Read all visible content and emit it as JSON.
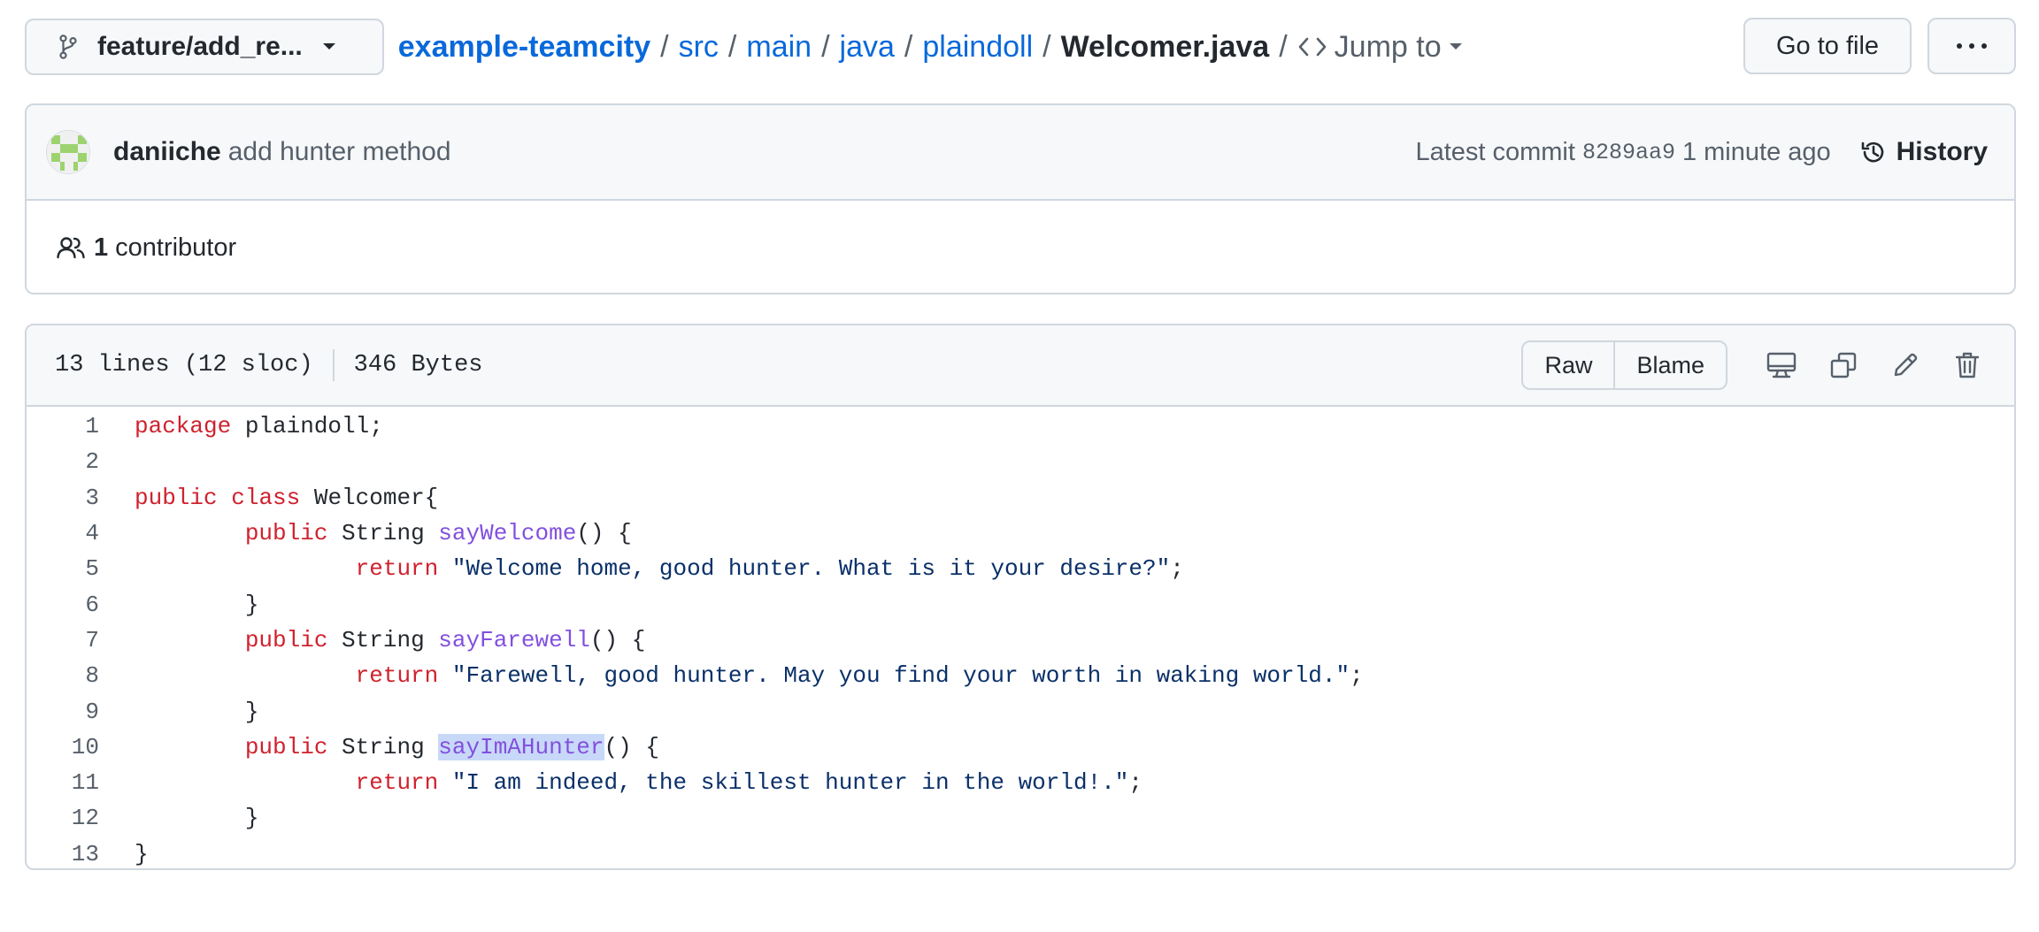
{
  "top": {
    "branch": "feature/add_re...",
    "breadcrumb": {
      "repo": "example-teamcity",
      "parts": [
        "src",
        "main",
        "java",
        "plaindoll"
      ],
      "file": "Welcomer.java",
      "separator": "/",
      "jump_to": "Jump to"
    },
    "go_to_file": "Go to file",
    "more": "···"
  },
  "commit": {
    "author": "daniiche",
    "message": "add hunter method",
    "latest_label": "Latest commit",
    "sha": "8289aa9",
    "time": "1 minute ago",
    "history": "History",
    "contributors_count": "1",
    "contributors_label": "contributor"
  },
  "file": {
    "lines_info": "13 lines (12 sloc)",
    "size": "346 Bytes",
    "raw": "Raw",
    "blame": "Blame",
    "code": [
      [
        {
          "t": "package",
          "c": "kw"
        },
        {
          "t": " plaindoll;"
        }
      ],
      [],
      [
        {
          "t": "public",
          "c": "kw"
        },
        {
          "t": " "
        },
        {
          "t": "class",
          "c": "kw"
        },
        {
          "t": " Welcomer{"
        }
      ],
      [
        {
          "t": "        "
        },
        {
          "t": "public",
          "c": "kw"
        },
        {
          "t": " String "
        },
        {
          "t": "sayWelcome",
          "c": "fn"
        },
        {
          "t": "() {"
        }
      ],
      [
        {
          "t": "                "
        },
        {
          "t": "return",
          "c": "kw"
        },
        {
          "t": " "
        },
        {
          "t": "\"Welcome home, good hunter. What is it your desire?\"",
          "c": "str"
        },
        {
          "t": ";"
        }
      ],
      [
        {
          "t": "        }"
        }
      ],
      [
        {
          "t": "        "
        },
        {
          "t": "public",
          "c": "kw"
        },
        {
          "t": " String "
        },
        {
          "t": "sayFarewell",
          "c": "fn"
        },
        {
          "t": "() {"
        }
      ],
      [
        {
          "t": "                "
        },
        {
          "t": "return",
          "c": "kw"
        },
        {
          "t": " "
        },
        {
          "t": "\"Farewell, good hunter. May you find your worth in waking world.\"",
          "c": "str"
        },
        {
          "t": ";"
        }
      ],
      [
        {
          "t": "        }"
        }
      ],
      [
        {
          "t": "        "
        },
        {
          "t": "public",
          "c": "kw"
        },
        {
          "t": " String "
        },
        {
          "t": "sayImAHunter",
          "c": "fn hl"
        },
        {
          "t": "() {"
        }
      ],
      [
        {
          "t": "                "
        },
        {
          "t": "return",
          "c": "kw"
        },
        {
          "t": " "
        },
        {
          "t": "\"I am indeed, the skillest hunter in the world!.\"",
          "c": "str"
        },
        {
          "t": ";"
        }
      ],
      [
        {
          "t": "        }"
        }
      ],
      [
        {
          "t": "}"
        }
      ]
    ]
  },
  "colors": {
    "link": "#0969da",
    "keyword": "#cf222e",
    "function": "#8250df",
    "string": "#0a3069",
    "highlight": "#c8d8f8"
  }
}
